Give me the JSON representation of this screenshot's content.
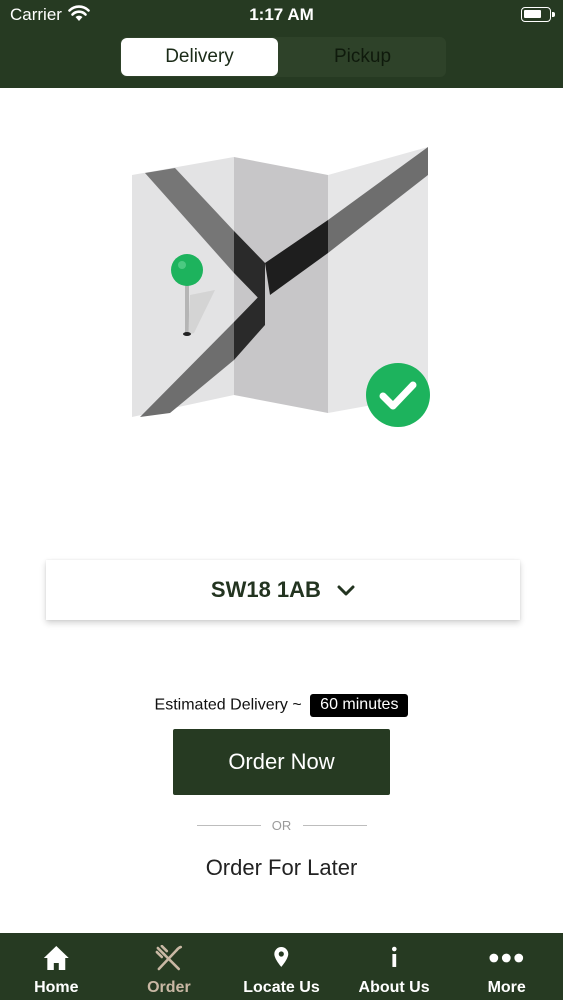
{
  "status_bar": {
    "carrier": "Carrier",
    "time": "1:17 AM"
  },
  "segments": {
    "delivery": "Delivery",
    "pickup": "Pickup",
    "selected": "Delivery"
  },
  "location": {
    "postcode": "SW18 1AB"
  },
  "estimate": {
    "label": "Estimated Delivery ~",
    "value": "60 minutes"
  },
  "actions": {
    "order_now": "Order Now",
    "or": "OR",
    "order_later": "Order For Later"
  },
  "tabs": [
    {
      "label": "Home",
      "icon": "home-icon"
    },
    {
      "label": "Order",
      "icon": "fork-knife-icon",
      "active": true
    },
    {
      "label": "Locate Us",
      "icon": "location-pin-icon"
    },
    {
      "label": "About Us",
      "icon": "info-icon"
    },
    {
      "label": "More",
      "icon": "more-dots-icon"
    }
  ],
  "colors": {
    "primary": "#263a22",
    "accent_green": "#1db35d",
    "inactive_tab_text": "#c9b8a4"
  }
}
